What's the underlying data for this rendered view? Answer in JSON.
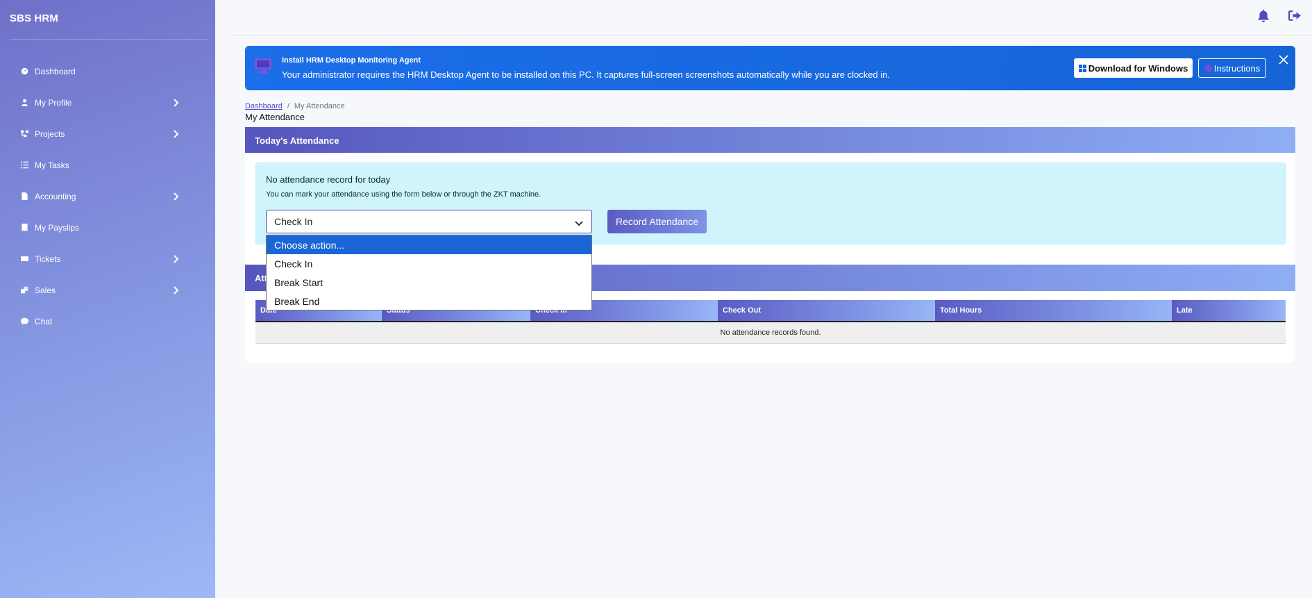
{
  "app": {
    "brand": "SBS HRM"
  },
  "sidebar": {
    "items": [
      {
        "label": "Dashboard",
        "icon": "gauge-icon",
        "has_children": false
      },
      {
        "label": "My Profile",
        "icon": "user-icon",
        "has_children": true
      },
      {
        "label": "Projects",
        "icon": "sitemap-icon",
        "has_children": true
      },
      {
        "label": "My Tasks",
        "icon": "list-check-icon",
        "has_children": false
      },
      {
        "label": "Accounting",
        "icon": "file-invoice-icon",
        "has_children": true
      },
      {
        "label": "My Payslips",
        "icon": "receipt-icon",
        "has_children": false
      },
      {
        "label": "Tickets",
        "icon": "ticket-icon",
        "has_children": true
      },
      {
        "label": "Sales",
        "icon": "boxes-icon",
        "has_children": true
      },
      {
        "label": "Chat",
        "icon": "chat-icon",
        "has_children": false
      }
    ]
  },
  "topbar": {
    "icons": [
      "bell-icon",
      "logout-icon"
    ]
  },
  "banner": {
    "title": "Install HRM Desktop Monitoring Agent",
    "text": "Your administrator requires the HRM Desktop Agent to be installed on this PC. It captures full-screen screenshots automatically while you are clocked in.",
    "download_label": "Download for Windows",
    "instructions_label": "Instructions"
  },
  "breadcrumb": {
    "home": "Dashboard",
    "separator": "/",
    "current": "My Attendance"
  },
  "page": {
    "title": "My Attendance"
  },
  "today": {
    "header": "Today's Attendance",
    "alert_title": "No attendance record for today",
    "alert_text": "You can mark your attendance using the form below or through the ZKT machine.",
    "select_value": "Check In",
    "record_button": "Record Attendance"
  },
  "dropdown": {
    "options": [
      "Choose action...",
      "Check In",
      "Break Start",
      "Break End"
    ],
    "highlighted_index": 0
  },
  "history": {
    "header": "Att",
    "columns": [
      "Date",
      "Status",
      "Check In",
      "Check Out",
      "Total Hours",
      "Late"
    ],
    "empty_text": "No attendance records found."
  },
  "colors": {
    "accent": "#4b4ec0",
    "banner": "#1565d8",
    "alert_bg": "#cff4fc",
    "selected_option": "#1a66d6"
  }
}
